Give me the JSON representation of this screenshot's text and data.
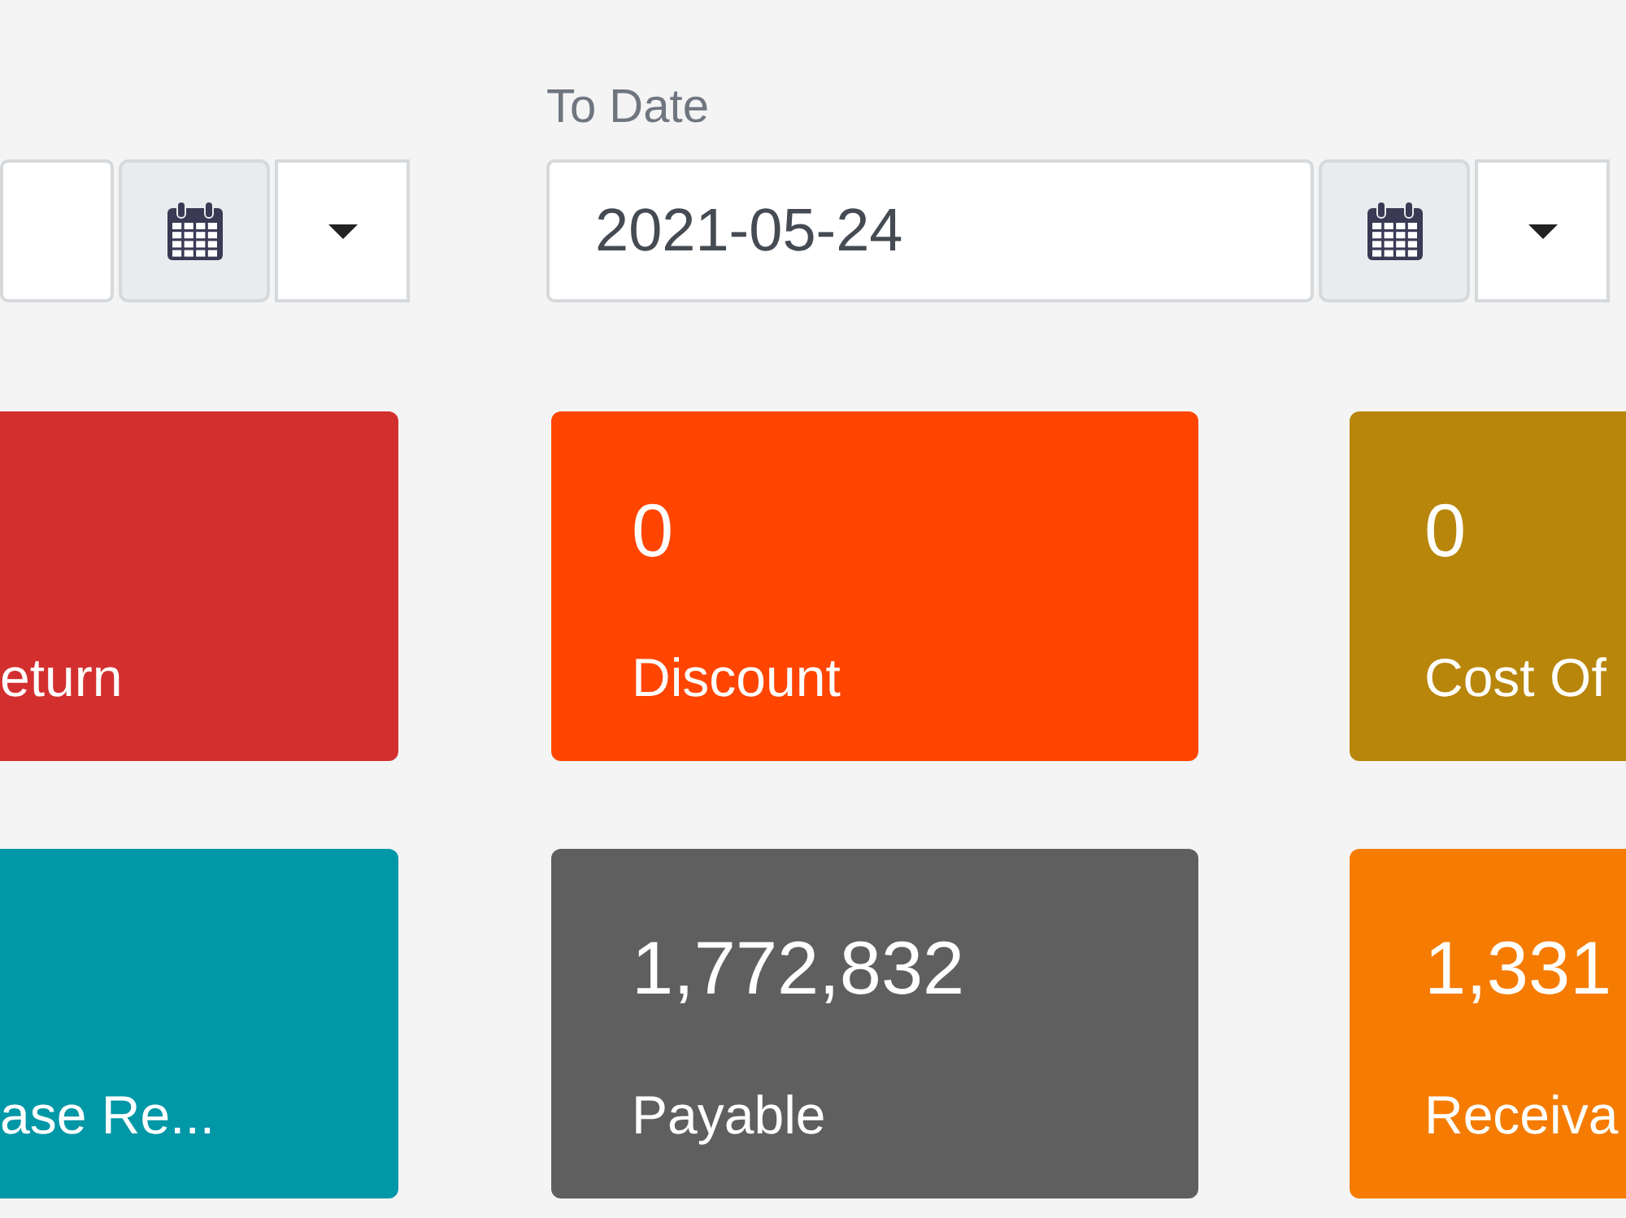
{
  "date_filters": [
    {
      "kind": "date"
    },
    {
      "kind": "date",
      "label": "To Date",
      "value": "2021-05-24"
    }
  ],
  "cards": [
    {
      "label": "eturn",
      "color": "#d32f2f"
    },
    {
      "value": "0",
      "label": "Discount",
      "color": "#ff4500"
    },
    {
      "value": "0",
      "label": "Cost Of",
      "color": "#b8860b"
    },
    {
      "label": "ase Re...",
      "color": "#0097a7"
    },
    {
      "value": "1,772,832",
      "label": "Payable",
      "color": "#5f5f5f"
    },
    {
      "value": "1,331",
      "label": "Receiva",
      "color": "#f57c00"
    }
  ]
}
